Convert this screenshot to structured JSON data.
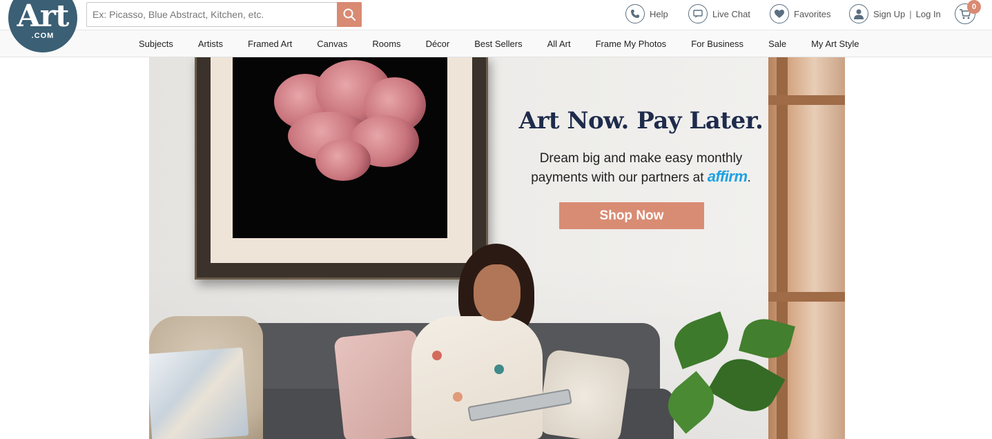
{
  "logo": {
    "word": "Art",
    "sub": ".COM"
  },
  "search": {
    "placeholder": "Ex: Picasso, Blue Abstract, Kitchen, etc.",
    "value": ""
  },
  "utility": {
    "help": "Help",
    "live_chat": "Live Chat",
    "favorites": "Favorites",
    "sign_up": "Sign Up",
    "separator": "|",
    "log_in": "Log In",
    "cart_count": "0"
  },
  "nav": {
    "items": [
      {
        "label": "Subjects"
      },
      {
        "label": "Artists"
      },
      {
        "label": "Framed Art"
      },
      {
        "label": "Canvas"
      },
      {
        "label": "Rooms"
      },
      {
        "label": "Décor"
      },
      {
        "label": "Best Sellers"
      },
      {
        "label": "All Art"
      },
      {
        "label": "Frame My Photos"
      },
      {
        "label": "For Business"
      },
      {
        "label": "Sale"
      },
      {
        "label": "My Art Style"
      }
    ]
  },
  "hero": {
    "title": "Art Now. Pay Later.",
    "subtitle_line1": "Dream big and make easy monthly",
    "subtitle_line2": "payments with our partners at",
    "partner": "affirm",
    "punct": ".",
    "cta": "Shop Now"
  },
  "colors": {
    "brand": "#3b5f74",
    "accent": "#d98a72",
    "title": "#1e2b4b",
    "affirm": "#1da1e3"
  },
  "icons": {
    "search": "search-icon",
    "help": "phone-icon",
    "chat": "chat-icon",
    "favorites": "heart-icon",
    "account": "user-icon",
    "cart": "cart-icon"
  }
}
